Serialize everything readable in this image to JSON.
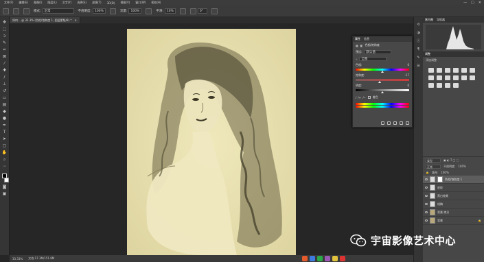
{
  "menubar": {
    "items": [
      "文件(F)",
      "编辑(E)",
      "图像(I)",
      "图层(L)",
      "文字(Y)",
      "选择(S)",
      "滤镜(T)",
      "3D(D)",
      "视图(V)",
      "窗口(W)",
      "帮助(H)"
    ],
    "window_controls": [
      "—",
      "□",
      "✕"
    ]
  },
  "options": {
    "mode_label": "模式:",
    "mode_value": "正常",
    "opacity_label": "不透明度:",
    "opacity_value": "100%",
    "flow_label": "流量:",
    "flow_value": "100%",
    "smooth_label": "平滑:",
    "smooth_value": "10%",
    "angle_value": "0°"
  },
  "document": {
    "tab_title": "如何... @ 33.3% (色相/饱和度 1, 图层蒙版/8) *"
  },
  "status": {
    "zoom": "33.33%",
    "doc_info": "文档:17.3M/151.8M"
  },
  "right_panel": {
    "histogram_tab": "直方图",
    "navigator_tab": "导航器",
    "adjustments_tab": "调整",
    "adjustments_subtitle": "添加调整"
  },
  "properties": {
    "tab_properties": "属性",
    "tab_info": "信息",
    "header": "色相/饱和度",
    "preset_label": "预设:",
    "preset_value": "默认值",
    "channel_value": "全图",
    "hue_label": "色相:",
    "hue_value": "0",
    "saturation_label": "饱和度:",
    "saturation_value": "-17",
    "lightness_label": "明度:",
    "lightness_value": "0",
    "colorize_label": "着色"
  },
  "layers": {
    "kind_label": "类型",
    "blend_mode": "正常",
    "opacity_label": "不透明度:",
    "opacity_value": "100%",
    "fill_label": "填充:",
    "fill_value": "100%",
    "rows": [
      {
        "name": "色相/饱和度 1"
      },
      {
        "name": "底纹"
      },
      {
        "name": "黑白效果"
      },
      {
        "name": "线稿"
      },
      {
        "name": "背景 拷贝"
      },
      {
        "name": "背景"
      }
    ]
  },
  "watermark": {
    "text": "宇宙影像艺术中心"
  },
  "colors": {
    "canvas_tint": "#e8e1b0",
    "ui_bg": "#262626",
    "panel_bg": "#474747"
  }
}
